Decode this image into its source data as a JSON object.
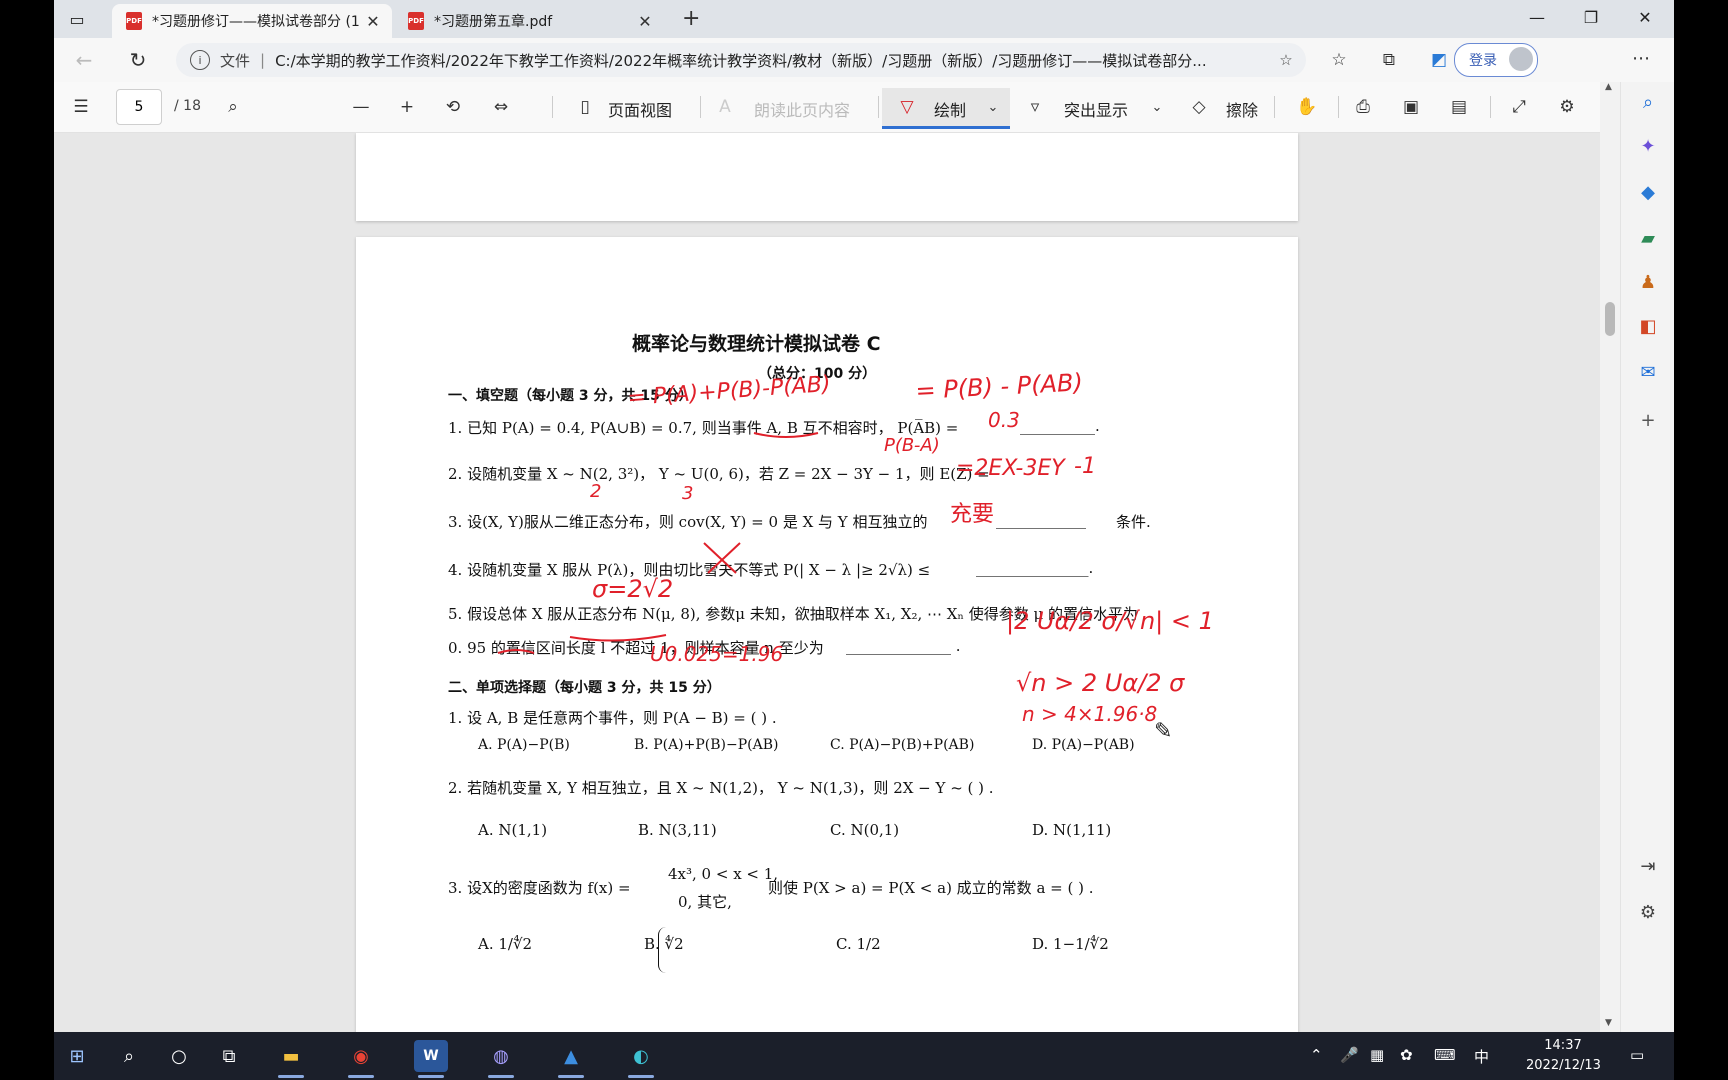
{
  "browser": {
    "tabs": [
      {
        "title": "*习题册修订——模拟试卷部分 (1",
        "active": true
      },
      {
        "title": "*习题册第五章.pdf",
        "active": false
      }
    ],
    "address": {
      "scheme": "文件",
      "url": "C:/本学期的教学工作资料/2022年下教学工作资料/2022年概率统计教学资料/教材（新版）/习题册（新版）/习题册修订——模拟试卷部分..."
    },
    "login_label": "登录"
  },
  "pdf_toolbar": {
    "page_current": "5",
    "page_total": "/ 18",
    "page_view_label": "页面视图",
    "read_aloud_label": "朗读此页内容",
    "draw_label": "绘制",
    "highlight_label": "突出显示",
    "erase_label": "擦除"
  },
  "document": {
    "title": "概率论与数理统计模拟试卷 C",
    "total": "（总分：100 分）",
    "section1": "一、填空题（每小题 3 分，共 15 分）",
    "q1": "1.  已知 P(A) = 0.4, P(A∪B) = 0.7, 则当事件 A, B 互不相容时，  P(A̅B) =",
    "q2": "2.  设随机变量 X ~ N(2, 3²)，  Y ~ U(0, 6)，若 Z = 2X − 3Y − 1，则 E(Z) =",
    "q3a": "3.  设(X, Y)服从二维正态分布，则 cov(X, Y) = 0 是 X 与 Y 相互独立的",
    "q3b": "条件.",
    "q4": "4.  设随机变量 X 服从 P(λ)，则由切比雪夫不等式 P(| X − λ |≥ 2√λ) ≤",
    "q5a": "5.  假设总体 X 服从正态分布 N(μ, 8), 参数μ 未知，欲抽取样本 X₁, X₂, ⋯ Xₙ 使得参数 μ 的置信水平为",
    "q5b": "0. 95 的置信区间长度 l 不超过 1，则样本容量 n 至少为",
    "section2": "二、单项选择题（每小题 3 分，共 15 分）",
    "mc1": "1.  设 A, B 是任意两个事件，则 P(A − B) = (        ) .",
    "mc1_opts": [
      "A.  P(A)−P(B)",
      "B.  P(A)+P(B)−P(AB)",
      "C.  P(A)−P(B)+P(AB)",
      "D.  P(A)−P(AB)"
    ],
    "mc2": "2.  若随机变量 X, Y 相互独立，且 X ~ N(1,2)，  Y ~ N(1,3)，则 2X − Y ~ (        ) .",
    "mc2_opts": [
      "A.  N(1,1)",
      "B.  N(3,11)",
      "C.  N(0,1)",
      "D.  N(1,11)"
    ],
    "mc3_a": "3.  设X的密度函数为 f(x) =",
    "mc3_case1": "4x³, 0 < x < 1,",
    "mc3_case2": "0, 其它,",
    "mc3_b": "则使 P(X > a) = P(X < a) 成立的常数 a = (        ) .",
    "mc3_opts": [
      "A.   1/∜2",
      "B.   ∜2",
      "C. 1/2",
      "D.  1−1/∜2"
    ]
  },
  "annotations": {
    "a1": "= P(A)+P(B)-P(AB)",
    "a2": "= P(B) - P(AB)",
    "a3": "P(B-A)",
    "a4": "0.3",
    "a5": "=2EX-3EY",
    "a6": "-1",
    "a7": "2",
    "a8": "3",
    "a9": "充要",
    "a10": "σ=2√2",
    "a11": "U0.025=1.96",
    "a12": "|2 Uα/2 σ/√n| < 1",
    "a13": "√n > 2 Uα/2 σ",
    "a14": "n > 4×1.96·8",
    "ink_color": "#e0202a"
  },
  "taskbar": {
    "time": "14:37",
    "date": "2022/12/13",
    "ime": "中"
  }
}
